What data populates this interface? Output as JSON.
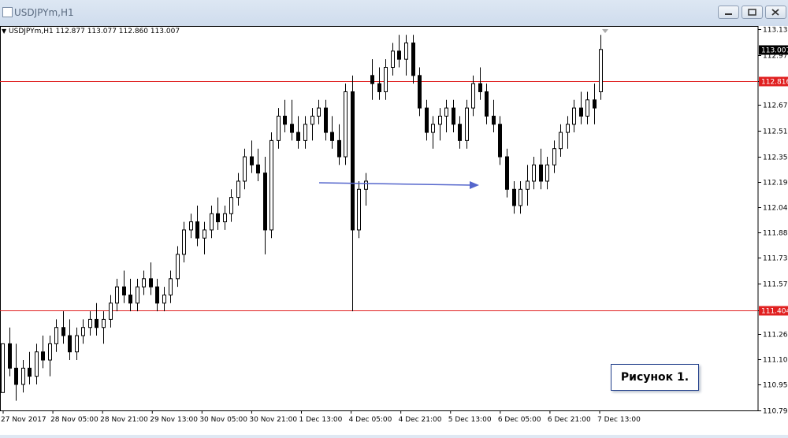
{
  "window": {
    "title": "USDJPYm,H1",
    "buttons": {
      "minimize": "minimize",
      "restore": "restore",
      "close": "close"
    }
  },
  "chart_header": "USDJPYm,H1  112.877 113.077 112.860 113.007",
  "annotation_label": "Рисунок 1.",
  "colors": {
    "candle": "#000000",
    "hline": "#e02020",
    "hline_label_bg": "#e02020",
    "arrow": "#5566cc",
    "price_label_bg": "#000000",
    "grid_bg": "#ffffff"
  },
  "chart_data": {
    "type": "candlestick",
    "symbol": "USDJPYm",
    "timeframe": "H1",
    "ohlc_current": {
      "open": 112.877,
      "high": 113.077,
      "low": 112.86,
      "close": 113.007
    },
    "y_ticks": [
      113.135,
      112.975,
      112.816,
      112.67,
      112.51,
      112.35,
      112.195,
      112.04,
      111.885,
      111.73,
      111.57,
      111.404,
      111.26,
      111.105,
      110.95,
      110.79
    ],
    "ylim": [
      110.79,
      113.135
    ],
    "x_ticks": [
      "27 Nov 2017",
      "28 Nov 05:00",
      "28 Nov 21:00",
      "29 Nov 13:00",
      "30 Nov 05:00",
      "30 Nov 21:00",
      "1 Dec 13:00",
      "4 Dec 05:00",
      "4 Dec 21:00",
      "5 Dec 13:00",
      "6 Dec 05:00",
      "6 Dec 21:00",
      "7 Dec 13:00"
    ],
    "horizontal_lines": [
      {
        "price": 112.816,
        "label": "112.816"
      },
      {
        "price": 111.404,
        "label": "111.404"
      }
    ],
    "current_price": {
      "price": 113.007,
      "label": "113.007"
    },
    "arrow": {
      "from_price": 112.19,
      "to_price": 112.19,
      "from_time": "1 Dec 16:00",
      "to_time": "6 Dec 03:00"
    },
    "candles": [
      [
        110.9,
        111.2,
        110.9,
        111.2
      ],
      [
        111.2,
        111.3,
        111.0,
        111.05
      ],
      [
        111.05,
        111.2,
        110.85,
        110.95
      ],
      [
        110.95,
        111.1,
        110.9,
        111.05
      ],
      [
        111.05,
        111.15,
        110.95,
        111.0
      ],
      [
        111.0,
        111.2,
        110.95,
        111.15
      ],
      [
        111.15,
        111.25,
        111.05,
        111.1
      ],
      [
        111.1,
        111.25,
        111.0,
        111.2
      ],
      [
        111.2,
        111.35,
        111.15,
        111.3
      ],
      [
        111.3,
        111.4,
        111.2,
        111.25
      ],
      [
        111.25,
        111.35,
        111.1,
        111.15
      ],
      [
        111.15,
        111.3,
        111.1,
        111.25
      ],
      [
        111.25,
        111.35,
        111.2,
        111.3
      ],
      [
        111.3,
        111.4,
        111.25,
        111.35
      ],
      [
        111.35,
        111.45,
        111.25,
        111.3
      ],
      [
        111.3,
        111.4,
        111.2,
        111.35
      ],
      [
        111.35,
        111.5,
        111.3,
        111.45
      ],
      [
        111.45,
        111.6,
        111.4,
        111.55
      ],
      [
        111.55,
        111.65,
        111.45,
        111.5
      ],
      [
        111.5,
        111.6,
        111.4,
        111.45
      ],
      [
        111.45,
        111.6,
        111.4,
        111.55
      ],
      [
        111.55,
        111.65,
        111.5,
        111.6
      ],
      [
        111.6,
        111.7,
        111.5,
        111.55
      ],
      [
        111.55,
        111.6,
        111.4,
        111.45
      ],
      [
        111.45,
        111.55,
        111.4,
        111.5
      ],
      [
        111.5,
        111.65,
        111.45,
        111.6
      ],
      [
        111.6,
        111.8,
        111.55,
        111.75
      ],
      [
        111.75,
        111.95,
        111.7,
        111.9
      ],
      [
        111.9,
        112.0,
        111.85,
        111.95
      ],
      [
        111.95,
        112.05,
        111.8,
        111.85
      ],
      [
        111.85,
        111.95,
        111.75,
        111.9
      ],
      [
        111.9,
        112.05,
        111.85,
        112.0
      ],
      [
        112.0,
        112.1,
        111.9,
        111.95
      ],
      [
        111.95,
        112.05,
        111.9,
        112.0
      ],
      [
        112.0,
        112.15,
        111.95,
        112.1
      ],
      [
        112.1,
        112.25,
        112.05,
        112.2
      ],
      [
        112.2,
        112.4,
        112.15,
        112.35
      ],
      [
        112.35,
        112.45,
        112.25,
        112.3
      ],
      [
        112.3,
        112.4,
        112.2,
        112.25
      ],
      [
        112.25,
        112.35,
        111.75,
        111.9
      ],
      [
        111.9,
        112.5,
        111.85,
        112.45
      ],
      [
        112.45,
        112.65,
        112.4,
        112.6
      ],
      [
        112.6,
        112.7,
        112.5,
        112.55
      ],
      [
        112.55,
        112.7,
        112.45,
        112.5
      ],
      [
        112.5,
        112.6,
        112.4,
        112.45
      ],
      [
        112.45,
        112.6,
        112.4,
        112.55
      ],
      [
        112.55,
        112.65,
        112.45,
        112.6
      ],
      [
        112.6,
        112.7,
        112.55,
        112.65
      ],
      [
        112.65,
        112.7,
        112.45,
        112.5
      ],
      [
        112.5,
        112.6,
        112.4,
        112.45
      ],
      [
        112.45,
        112.55,
        112.3,
        112.35
      ],
      [
        112.35,
        112.8,
        112.3,
        112.75
      ],
      [
        112.75,
        112.85,
        111.4,
        111.9
      ],
      [
        111.9,
        112.2,
        111.85,
        112.15
      ],
      [
        112.15,
        112.25,
        112.05,
        112.2
      ],
      [
        112.85,
        112.95,
        112.7,
        112.8
      ],
      [
        112.8,
        112.9,
        112.7,
        112.75
      ],
      [
        112.75,
        112.95,
        112.7,
        112.9
      ],
      [
        112.9,
        113.05,
        112.85,
        113.0
      ],
      [
        113.0,
        113.1,
        112.9,
        112.95
      ],
      [
        112.95,
        113.1,
        112.85,
        113.05
      ],
      [
        113.05,
        113.1,
        112.8,
        112.85
      ],
      [
        112.85,
        112.9,
        112.6,
        112.65
      ],
      [
        112.65,
        112.7,
        112.45,
        112.5
      ],
      [
        112.5,
        112.6,
        112.4,
        112.55
      ],
      [
        112.55,
        112.65,
        112.45,
        112.6
      ],
      [
        112.6,
        112.7,
        112.5,
        112.65
      ],
      [
        112.65,
        112.7,
        112.5,
        112.55
      ],
      [
        112.55,
        112.6,
        112.4,
        112.45
      ],
      [
        112.45,
        112.7,
        112.4,
        112.65
      ],
      [
        112.65,
        112.85,
        112.6,
        112.8
      ],
      [
        112.8,
        112.9,
        112.7,
        112.75
      ],
      [
        112.75,
        112.8,
        112.55,
        112.6
      ],
      [
        112.6,
        112.7,
        112.5,
        112.55
      ],
      [
        112.55,
        112.6,
        112.3,
        112.35
      ],
      [
        112.35,
        112.4,
        112.1,
        112.15
      ],
      [
        112.15,
        112.2,
        112.0,
        112.05
      ],
      [
        112.05,
        112.2,
        112.0,
        112.15
      ],
      [
        112.15,
        112.3,
        112.05,
        112.2
      ],
      [
        112.2,
        112.35,
        112.15,
        112.3
      ],
      [
        112.3,
        112.4,
        112.15,
        112.2
      ],
      [
        112.2,
        112.35,
        112.15,
        112.3
      ],
      [
        112.3,
        112.45,
        112.25,
        112.4
      ],
      [
        112.4,
        112.55,
        112.35,
        112.5
      ],
      [
        112.5,
        112.6,
        112.4,
        112.55
      ],
      [
        112.55,
        112.7,
        112.5,
        112.65
      ],
      [
        112.65,
        112.75,
        112.55,
        112.6
      ],
      [
        112.6,
        112.75,
        112.55,
        112.7
      ],
      [
        112.7,
        112.8,
        112.55,
        112.65
      ],
      [
        112.75,
        113.1,
        112.7,
        113.01
      ]
    ]
  }
}
